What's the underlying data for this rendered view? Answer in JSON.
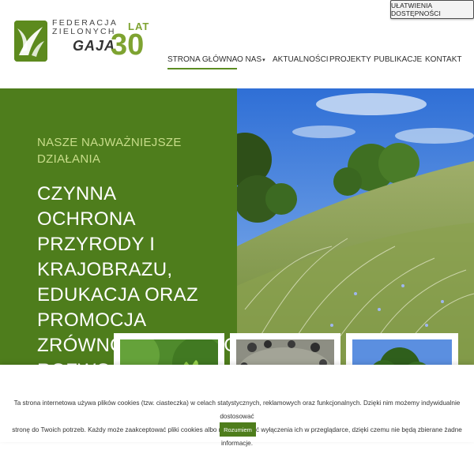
{
  "accessibility": {
    "label": "UŁATWIENIA DOSTĘPNOŚCI"
  },
  "logo": {
    "line1": "FEDERACJA",
    "line2": "ZIELONYCH",
    "name": "GAJA",
    "anniversary_number": "30",
    "anniversary_word": "LAT"
  },
  "nav": {
    "items": [
      {
        "label": "STRONA GŁÓWNA",
        "active": true
      },
      {
        "label": "O NAS",
        "has_dropdown": true
      },
      {
        "label": "AKTUALNOŚCI"
      },
      {
        "label": "PROJEKTY"
      },
      {
        "label": "PUBLIKACJE"
      },
      {
        "label": "KONTAKT"
      }
    ],
    "dropdown_glyph": "▾"
  },
  "hero": {
    "kicker_line1": "NASZE NAJWAŻNIEJSZE",
    "kicker_line2": "DZIAŁANIA",
    "headline_lines": [
      "CZYNNA",
      "OCHRONA",
      "PRZYRODY I",
      "KRAJOBRAZU,",
      "EDUKACJA ORAZ",
      "PROMOCJA",
      "ZRÓWNOWAŻONEGO",
      "ROZWOJU"
    ]
  },
  "cookie": {
    "line1": "Ta strona internetowa używa plików cookies (tzw. ciasteczka) w celach statystycznych, reklamowych oraz funkcjonalnych. Dzięki nim możemy indywidualnie dostosować",
    "line2": "stronę do Twoich potrzeb. Każdy może zaakceptować pliki cookies albo ma możliwość wyłączenia ich w przeglądarce, dzięki czemu nie będą zbierane żadne informacje.",
    "button": "Rozumiem"
  },
  "colors": {
    "brand_green": "#4e7d1c",
    "logo_green": "#7ea331",
    "kicker_green": "#c8dd8a"
  },
  "icons": [
    "leaf-logo-icon",
    "chevron-down-icon"
  ]
}
